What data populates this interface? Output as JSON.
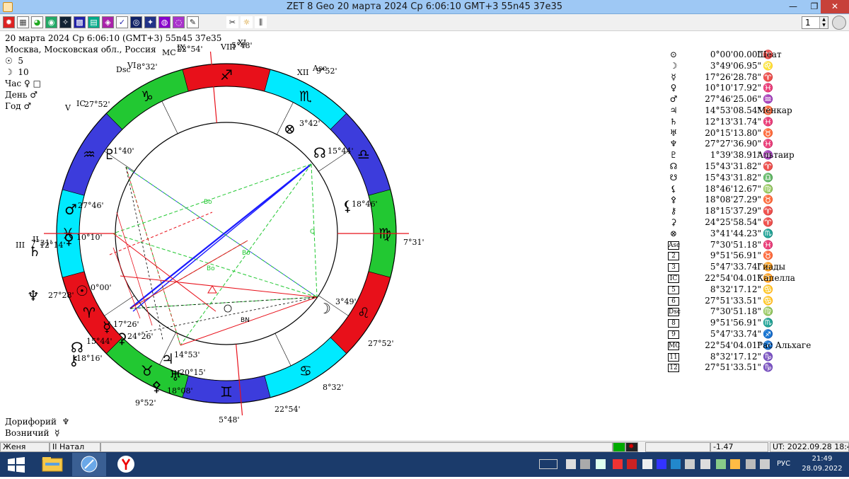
{
  "window": {
    "title": "ZET 8 Geo   20 марта 2024  Ср   6:06:10 GMT+3 55n45  37e35",
    "minimize_label": "—",
    "maximize_label": "❐",
    "close_label": "✕"
  },
  "toolbar": {
    "icons": [
      "sun-icon",
      "table-icon",
      "globe-icon",
      "earth-icon",
      "chart-icon",
      "grid-icon",
      "book-icon",
      "heart-icon",
      "target-icon",
      "circle-icon",
      "star-icon",
      "tools-icon",
      "settings-icon",
      "calendar-icon"
    ],
    "spinner_value": "1"
  },
  "info": {
    "date_line": "20 марта 2024  Ср   6:06:10 (GMT+3)  55n45  37e35",
    "place_line": "Москва, Московская обл., Россия",
    "lines": [
      {
        "glyph": "☉",
        "text": "5"
      },
      {
        "glyph": "☽",
        "text": "10"
      },
      {
        "label": "Час",
        "text": "♀ □"
      },
      {
        "label": "День",
        "text": "♂"
      },
      {
        "label": "Год",
        "text": "♂"
      }
    ],
    "bottom_lines": [
      {
        "label": "Дорифорий",
        "text": "♆"
      },
      {
        "label": "Возничий",
        "text": "☿"
      }
    ]
  },
  "chart": {
    "houses": [
      {
        "label": "MC",
        "value": "22°54'"
      },
      {
        "label": "IX",
        "value": "5°48'"
      },
      {
        "label": "VIII",
        "value": "9°52'"
      },
      {
        "label": "XI",
        "value": "8°32'"
      },
      {
        "label": "XII",
        "value": "27°52'"
      },
      {
        "label": "Asc",
        "value": "7°31'"
      },
      {
        "label": "Dsc",
        "value": "7°31'"
      },
      {
        "label": "VI",
        "value": "27°52'"
      },
      {
        "label": "V",
        "value": "8°32'"
      },
      {
        "label": "IC",
        "value": "22°54'"
      },
      {
        "label": "III",
        "value": "5°48'"
      },
      {
        "label": "II",
        "value": "9°52'"
      }
    ],
    "planet_labels": [
      {
        "glyph": "♇",
        "value": "1°40'"
      },
      {
        "glyph": "☊",
        "value": "15°44'"
      },
      {
        "glyph": "⊗",
        "value": "3°42'"
      },
      {
        "glyph": "⚸",
        "value": "18°46'"
      },
      {
        "glyph": "♂",
        "value": "27°46'"
      },
      {
        "glyph": "♀",
        "value": "10°10'"
      },
      {
        "glyph": "♄",
        "value": "12°14'"
      },
      {
        "glyph": "♆",
        "value": "27°28'"
      },
      {
        "glyph": "☉",
        "value": "0°00'"
      },
      {
        "glyph": "☽",
        "value": "3°49'"
      },
      {
        "glyph": "☿",
        "value": "17°26'"
      },
      {
        "glyph": "⚳",
        "value": "24°26'"
      },
      {
        "glyph": "☊",
        "value": "15°44'"
      },
      {
        "glyph": "⚷",
        "value": "18°16'"
      },
      {
        "glyph": "♃",
        "value": "14°53'"
      },
      {
        "glyph": "♅",
        "value": "20°15'"
      },
      {
        "glyph": "⚴",
        "value": "18°08'"
      }
    ],
    "signs": [
      "♐",
      "♏",
      "♎",
      "♍",
      "♌",
      "♋",
      "♊",
      "♉",
      "♈",
      "♓",
      "♒",
      "♑"
    ],
    "inner_labels": [
      "Bo",
      "Bo",
      "Bo",
      "Q",
      "BN"
    ],
    "colors": {
      "fire": "#e8101a",
      "earth": "#22c832",
      "air": "#00eaff",
      "water": "#3c3cdc"
    }
  },
  "planets": [
    {
      "glyph": "⊙",
      "value": "0°00'00.00\"",
      "sign": "♈",
      "star": "Шеат"
    },
    {
      "glyph": "☽",
      "value": "3°49'06.95\"",
      "sign": "♌",
      "star": ""
    },
    {
      "glyph": "☿",
      "value": "17°26'28.78\"",
      "sign": "♈",
      "star": ""
    },
    {
      "glyph": "♀",
      "value": "10°10'17.92\"",
      "sign": "♓",
      "star": ""
    },
    {
      "glyph": "♂",
      "value": "27°46'25.06\"",
      "sign": "♒",
      "star": ""
    },
    {
      "glyph": "♃",
      "value": "14°53'08.54\"",
      "sign": "♉",
      "star": "Менкар"
    },
    {
      "glyph": "♄",
      "value": "12°13'31.74\"",
      "sign": "♓",
      "star": ""
    },
    {
      "glyph": "♅",
      "value": "20°15'13.80\"",
      "sign": "♉",
      "star": ""
    },
    {
      "glyph": "♆",
      "value": "27°27'36.90\"",
      "sign": "♓",
      "star": ""
    },
    {
      "glyph": "♇",
      "value": "1°39'38.91\"",
      "sign": "♒",
      "star": "Альтаир"
    },
    {
      "glyph": "☊",
      "value": "15°43'31.82\"",
      "sign": "♈",
      "star": ""
    },
    {
      "glyph": "☋",
      "value": "15°43'31.82\"",
      "sign": "♎",
      "star": ""
    },
    {
      "glyph": "⚸",
      "value": "18°46'12.67\"",
      "sign": "♍",
      "star": ""
    },
    {
      "glyph": "⚴",
      "value": "18°08'27.29\"",
      "sign": "♉",
      "star": ""
    },
    {
      "glyph": "⚷",
      "value": "18°15'37.29\"",
      "sign": "♈",
      "star": ""
    },
    {
      "glyph": "⚳",
      "value": "24°25'58.54\"",
      "sign": "♈",
      "star": ""
    },
    {
      "glyph": "⊗",
      "value": "3°41'44.23\"",
      "sign": "♏",
      "star": ""
    },
    {
      "glyph": "Asc",
      "value": "7°30'51.18\"",
      "sign": "♓",
      "star": ""
    },
    {
      "glyph": "2",
      "value": "9°51'56.91\"",
      "sign": "♉",
      "star": ""
    },
    {
      "glyph": "3",
      "value": "5°47'33.74\"",
      "sign": "♊",
      "star": "Гиады"
    },
    {
      "glyph": "IC",
      "value": "22°54'04.01\"",
      "sign": "♊",
      "star": "Капелла"
    },
    {
      "glyph": "5",
      "value": "8°32'17.12\"",
      "sign": "♋",
      "star": ""
    },
    {
      "glyph": "6",
      "value": "27°51'33.51\"",
      "sign": "♋",
      "star": ""
    },
    {
      "glyph": "Dsc",
      "value": "7°30'51.18\"",
      "sign": "♍",
      "star": ""
    },
    {
      "glyph": "8",
      "value": "9°51'56.91\"",
      "sign": "♏",
      "star": ""
    },
    {
      "glyph": "9",
      "value": "5°47'33.74\"",
      "sign": "♐",
      "star": ""
    },
    {
      "glyph": "MC",
      "value": "22°54'04.01\"",
      "sign": "♐",
      "star": "Рас Альхаге"
    },
    {
      "glyph": "11",
      "value": "8°32'17.12\"",
      "sign": "♑",
      "star": ""
    },
    {
      "glyph": "12",
      "value": "27°51'33.51\"",
      "sign": "♑",
      "star": ""
    }
  ],
  "status": {
    "user": "Женя",
    "mode": "II Натал",
    "value": "-1.47",
    "ut": "UT: 2022.09.28 18:49:13"
  },
  "taskbar": {
    "lang": "РУС",
    "time": "21:49",
    "date": "28.09.2022"
  }
}
